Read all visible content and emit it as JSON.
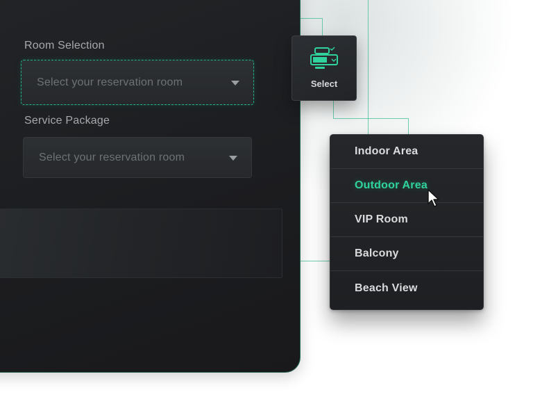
{
  "form": {
    "room_label": "Room Selection",
    "room_placeholder": "Select your reservation room",
    "service_label": "Service Package",
    "service_placeholder": "Select your reservation room"
  },
  "select_card": {
    "label": "Select",
    "icon": "select-component-icon"
  },
  "dropdown": {
    "items": [
      {
        "label": "Indoor Area"
      },
      {
        "label": "Outdoor Area"
      },
      {
        "label": "VIP Room"
      },
      {
        "label": "Balcony"
      },
      {
        "label": "Beach View"
      }
    ],
    "highlighted_index": 1
  },
  "colors": {
    "accent": "#2fd39b",
    "panel": "#1e1f22",
    "text": "#d9dbdd"
  }
}
